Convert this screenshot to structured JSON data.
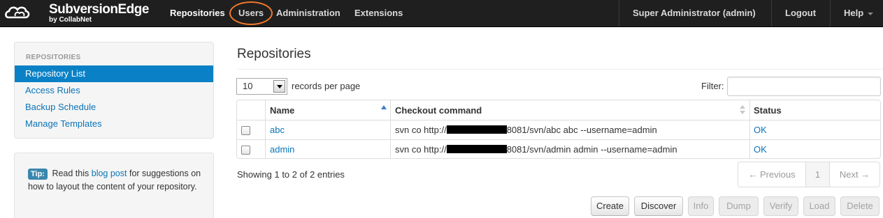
{
  "brand": {
    "name": "SubversionEdge",
    "byline": "by CollabNet"
  },
  "navbar": {
    "items": [
      {
        "label": "Repositories",
        "active": true
      },
      {
        "label": "Users",
        "active": false
      },
      {
        "label": "Administration",
        "active": false
      },
      {
        "label": "Extensions",
        "active": false
      }
    ],
    "user": "Super Administrator (admin)",
    "logout": "Logout",
    "help": "Help"
  },
  "sidebar": {
    "header": "REPOSITORIES",
    "items": [
      {
        "label": "Repository List",
        "active": true
      },
      {
        "label": "Access Rules",
        "active": false
      },
      {
        "label": "Backup Schedule",
        "active": false
      },
      {
        "label": "Manage Templates",
        "active": false
      }
    ]
  },
  "tip": {
    "badge": "Tip:",
    "before": "Read this",
    "link": "blog post",
    "after": "for suggestions on how to layout the content of your repository."
  },
  "main": {
    "title": "Repositories",
    "page_length": "10",
    "page_length_label": "records per page",
    "filter_label": "Filter:",
    "filter_value": "",
    "columns": [
      "Name",
      "Checkout command",
      "Status"
    ],
    "rows": [
      {
        "name": "abc",
        "cmd_prefix": "svn co http://",
        "cmd_suffix": "8081/svn/abc abc --username=admin",
        "status": "OK"
      },
      {
        "name": "admin",
        "cmd_prefix": "svn co http://",
        "cmd_suffix": "8081/svn/admin admin --username=admin",
        "status": "OK"
      }
    ],
    "info": "Showing 1 to 2 of 2 entries",
    "pagination": {
      "previous": "← Previous",
      "current": "1",
      "next": "Next →"
    },
    "buttons": [
      {
        "label": "Create",
        "enabled": true
      },
      {
        "label": "Discover",
        "enabled": true
      },
      {
        "label": "Info",
        "enabled": false
      },
      {
        "label": "Dump",
        "enabled": false
      },
      {
        "label": "Verify",
        "enabled": false
      },
      {
        "label": "Load",
        "enabled": false
      },
      {
        "label": "Delete",
        "enabled": false
      }
    ]
  },
  "colors": {
    "navbar_bg": "#1f1f1f",
    "link": "#0a74b8",
    "active_item_bg": "#0a81c6",
    "annotation_ring": "#f2792a",
    "tip_badge": "#3a87ad"
  },
  "icons": [
    "collabnet-logo-icon",
    "caret-down-icon",
    "sort-asc-icon",
    "sort-both-icon",
    "select-arrow-icon"
  ]
}
